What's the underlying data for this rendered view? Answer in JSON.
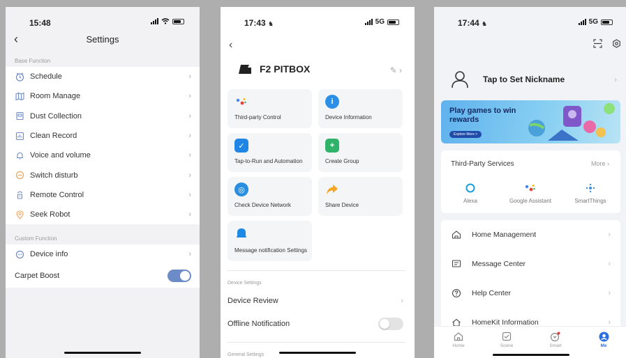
{
  "phone1": {
    "time": "15:48",
    "title": "Settings",
    "base_label": "Base Function",
    "base_items": [
      {
        "label": "Schedule",
        "icon": "clock-icon"
      },
      {
        "label": "Room Manage",
        "icon": "map-icon"
      },
      {
        "label": "Dust Collection",
        "icon": "dustbin-icon"
      },
      {
        "label": "Clean Record",
        "icon": "record-icon"
      },
      {
        "label": "Voice and volume",
        "icon": "bell-icon"
      },
      {
        "label": "Switch disturb",
        "icon": "disturb-icon"
      },
      {
        "label": "Remote Control",
        "icon": "remote-icon"
      },
      {
        "label": "Seek Robot",
        "icon": "location-icon"
      }
    ],
    "custom_label": "Custom Function",
    "custom_items": [
      {
        "label": "Device info",
        "icon": "info-icon"
      }
    ],
    "carpet_boost": {
      "label": "Carpet Boost",
      "enabled": true
    },
    "accent": "#6d8bc7"
  },
  "phone2": {
    "time": "17:43",
    "network": "5G",
    "device_name": "F2 PITBOX",
    "tiles": [
      {
        "label": "Third-party Control",
        "icon": "google-assistant-icon",
        "color": "#ffffff"
      },
      {
        "label": "Device Information",
        "icon": "info-icon",
        "color": "#2b8fe8"
      },
      {
        "label": "Tap-to-Run and Automation",
        "icon": "shield-check-icon",
        "color": "#1f86e6"
      },
      {
        "label": "Create Group",
        "icon": "group-add-icon",
        "color": "#2fb36a"
      },
      {
        "label": "Check Device Network",
        "icon": "wifi-check-icon",
        "color": "#2a8ee0"
      },
      {
        "label": "Share Device",
        "icon": "share-arrow-icon",
        "color": "#f5a623"
      },
      {
        "label": "Message notification Settings",
        "icon": "bell-icon",
        "color": "#1e88e5"
      }
    ],
    "device_settings_label": "Device Settings",
    "device_review": "Device Review",
    "offline_notification": "Offline Notification",
    "offline_enabled": false,
    "general_settings_label": "General Settings"
  },
  "phone3": {
    "time": "17:44",
    "network": "5G",
    "nickname": "Tap to Set Nickname",
    "banner": {
      "title": "Play games to win rewards",
      "button": "Explore More >"
    },
    "third_party": {
      "title": "Third-Party Services",
      "more": "More",
      "services": [
        {
          "name": "Alexa",
          "icon": "alexa-icon"
        },
        {
          "name": "Google Assistant",
          "icon": "google-assistant-icon"
        },
        {
          "name": "SmartThings",
          "icon": "smartthings-icon"
        }
      ]
    },
    "menu": [
      {
        "label": "Home Management",
        "icon": "home-icon"
      },
      {
        "label": "Message Center",
        "icon": "message-icon"
      },
      {
        "label": "Help Center",
        "icon": "help-icon"
      },
      {
        "label": "HomeKit Information",
        "icon": "homekit-icon"
      }
    ],
    "tabs": [
      {
        "label": "Home",
        "icon": "home-icon",
        "active": false
      },
      {
        "label": "Scene",
        "icon": "scene-check-icon",
        "active": false
      },
      {
        "label": "Smart",
        "icon": "smart-icon",
        "active": false
      },
      {
        "label": "Me",
        "icon": "me-icon",
        "active": true
      }
    ]
  }
}
